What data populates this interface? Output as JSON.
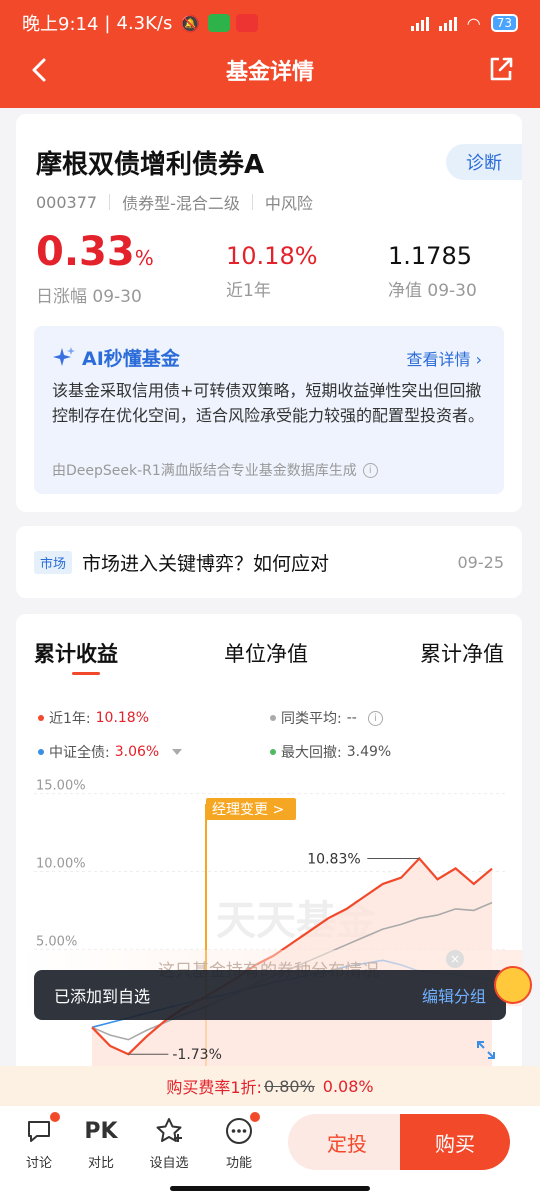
{
  "status_bar": {
    "time": "晚上9:14",
    "speed": "4.3K/s",
    "battery": "73"
  },
  "header": {
    "title": "基金详情"
  },
  "fund": {
    "name": "摩根双债增利债券A",
    "diagnose_label": "诊断",
    "code": "000377",
    "type": "债券型-混合二级",
    "risk": "中风险",
    "daily_change_value": "0.33",
    "daily_change_unit": "%",
    "daily_change_label": "日涨幅 09-30",
    "year_return": "10.18%",
    "year_return_label": "近1年",
    "nav": "1.1785",
    "nav_label": "净值 09-30"
  },
  "ai": {
    "title": "AI秒懂基金",
    "more": "查看详情",
    "summary": "该基金采取信用债+可转债双策略，短期收益弹性突出但回撤控制存在优化空间，适合风险承受能力较强的配置型投资者。",
    "source": "由DeepSeek-R1满血版结合专业基金数据库生成"
  },
  "news": {
    "tag": "市场",
    "title": "市场进入关键博弈？如何应对",
    "date": "09-25"
  },
  "chart_tabs": [
    "累计收益",
    "单位净值",
    "累计净值"
  ],
  "legend": {
    "fund_label": "近1年:",
    "fund_value": "10.18%",
    "peer_label": "同类平均:",
    "peer_value": "--",
    "index_label": "中证全债:",
    "index_value": "3.06%",
    "drawdown_label": "最大回撤:",
    "drawdown_value": "3.49%"
  },
  "chart_data": {
    "type": "line",
    "y_ticks": [
      "15.00%",
      "10.00%",
      "5.00%"
    ],
    "annotations": {
      "max": "10.83%",
      "min": "-1.73%",
      "event": "经理变更 >"
    },
    "watermark": "天天基金",
    "series": [
      {
        "name": "近1年",
        "color": "#f2492b",
        "values": [
          0.0,
          -1.2,
          -1.73,
          -0.6,
          0.4,
          1.2,
          1.8,
          2.5,
          3.2,
          4.0,
          4.6,
          5.4,
          6.2,
          7.0,
          7.6,
          8.4,
          9.2,
          9.6,
          10.83,
          9.5,
          10.2,
          9.2,
          10.18
        ]
      },
      {
        "name": "同类平均",
        "color": "#aaaaaa",
        "values": [
          0.0,
          -0.5,
          -0.8,
          -0.2,
          0.3,
          0.8,
          1.2,
          1.7,
          2.2,
          2.8,
          3.3,
          3.8,
          4.3,
          4.8,
          5.3,
          5.8,
          6.3,
          6.6,
          7.0,
          7.2,
          7.6,
          7.5,
          8.0
        ]
      },
      {
        "name": "中证全债",
        "color": "#3a8ee6",
        "values": [
          0.0,
          0.3,
          0.6,
          0.9,
          1.2,
          1.5,
          1.8,
          2.0,
          2.3,
          2.6,
          2.9,
          3.1,
          3.4,
          3.6,
          3.9,
          4.1,
          4.3,
          4.0,
          3.6,
          3.5,
          3.4,
          3.2,
          3.06
        ]
      }
    ],
    "ylim": [
      -3,
      16
    ]
  },
  "banner": {
    "text": "这只基金持有的券种分布情况"
  },
  "toast": {
    "message": "已添加到自选",
    "action": "编辑分组"
  },
  "fee": {
    "label": "购买费率1折:",
    "original": "0.80%",
    "discounted": "0.08%"
  },
  "bottom_bar": {
    "discuss": "讨论",
    "pk_icon": "PK",
    "compare": "对比",
    "watchlist": "设自选",
    "functions": "功能",
    "sip": "定投",
    "buy": "购买"
  }
}
